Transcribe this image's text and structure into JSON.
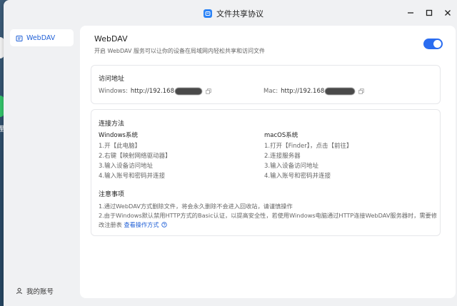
{
  "window": {
    "title": "文件共享协议"
  },
  "sidebar": {
    "items": [
      {
        "label": "WebDAV",
        "icon": "webdav-icon",
        "active": true
      }
    ],
    "account_label": "我的账号"
  },
  "main": {
    "title": "WebDAV",
    "description": "开启 WebDAV 服务可以让你的设备在局域网内轻松共享和访问文件",
    "toggle_on": true,
    "address": {
      "title": "访问地址",
      "windows_label": "Windows:",
      "windows_value": "http://192.168",
      "mac_label": "Mac:",
      "mac_value": "http://192.168"
    },
    "connection": {
      "title": "连接方法",
      "windows_title": "Windows系统",
      "windows_steps": [
        "1.开【此电脑】",
        "2.右键【映射网络驱动器】",
        "3.输入设备访问地址",
        "4.输入账号和密码并连接"
      ],
      "mac_title": "macOS系统",
      "mac_steps": [
        "1.打开【Finder】，点击【前往】",
        "2.连接服务器",
        "3.输入设备访问地址",
        "4.输入账号和密码并连接"
      ],
      "notes_title": "注意事项",
      "note1": "1.通过WebDAV方式删除文件，将会永久删除不会进入回收站，请谨慎操作",
      "note2": "2.由于Windows默认禁用HTTP方式的Basic认证，以提高安全性，若使用Windows电脑通过HTTP连接WebDAV服务器时，需要修改注册表",
      "note2_link": "查看操作方式"
    }
  },
  "colors": {
    "accent": "#2a6cf0",
    "link": "#1f5fd6",
    "window_bg": "#f0f1f3"
  }
}
